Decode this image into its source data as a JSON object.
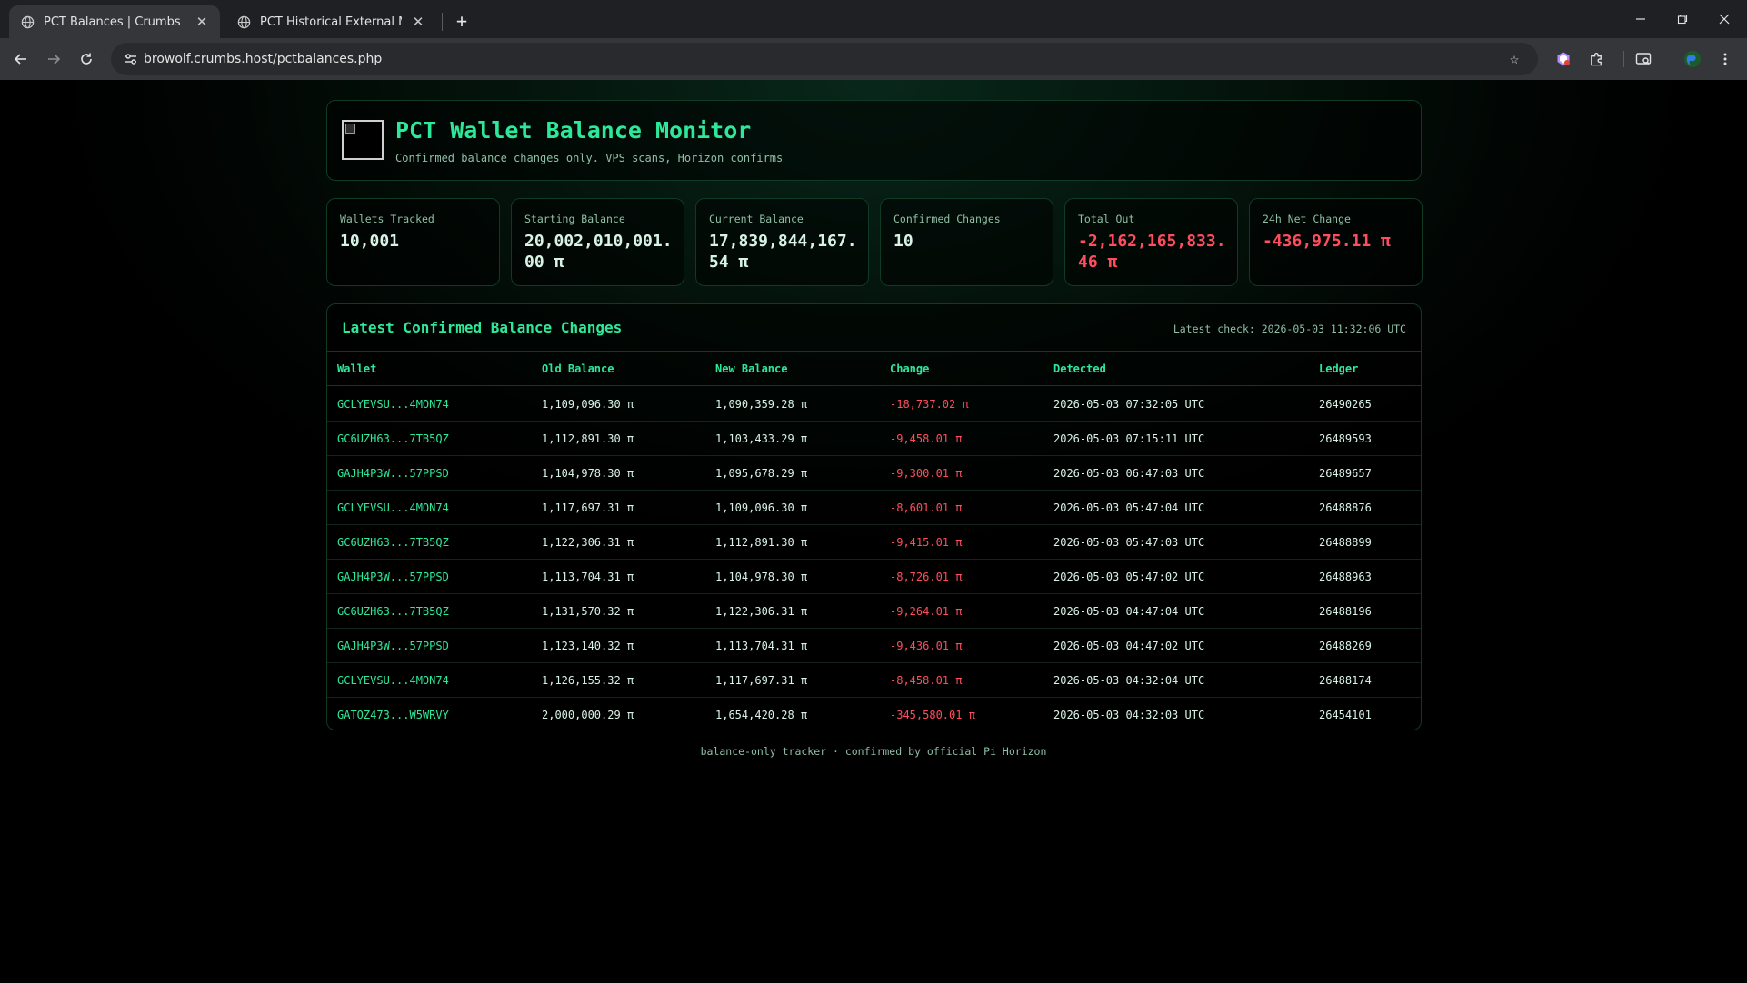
{
  "browser": {
    "tabs": [
      {
        "title": "PCT Balances | Crumbs",
        "active": true
      },
      {
        "title": "PCT Historical External Movements",
        "active": false
      }
    ],
    "url": "browolf.crumbs.host/pctbalances.php"
  },
  "header": {
    "title": "PCT Wallet Balance Monitor",
    "subtitle": "Confirmed balance changes only. VPS scans, Horizon confirms"
  },
  "stats": [
    {
      "label": "Wallets Tracked",
      "value": "10,001",
      "negative": false
    },
    {
      "label": "Starting Balance",
      "value": "20,002,010,001.00 π",
      "negative": false
    },
    {
      "label": "Current Balance",
      "value": "17,839,844,167.54 π",
      "negative": false
    },
    {
      "label": "Confirmed Changes",
      "value": "10",
      "negative": false
    },
    {
      "label": "Total Out",
      "value": "-2,162,165,833.46 π",
      "negative": true
    },
    {
      "label": "24h Net Change",
      "value": "-436,975.11 π",
      "negative": true
    }
  ],
  "table": {
    "title": "Latest Confirmed Balance Changes",
    "latest_check": "Latest check: 2026-05-03 11:32:06 UTC",
    "columns": [
      "Wallet",
      "Old Balance",
      "New Balance",
      "Change",
      "Detected",
      "Ledger"
    ],
    "rows": [
      [
        "GCLYEVSU...4MON74",
        "1,109,096.30 π",
        "1,090,359.28 π",
        "-18,737.02 π",
        "2026-05-03 07:32:05 UTC",
        "26490265"
      ],
      [
        "GC6UZH63...7TB5QZ",
        "1,112,891.30 π",
        "1,103,433.29 π",
        "-9,458.01 π",
        "2026-05-03 07:15:11 UTC",
        "26489593"
      ],
      [
        "GAJH4P3W...57PPSD",
        "1,104,978.30 π",
        "1,095,678.29 π",
        "-9,300.01 π",
        "2026-05-03 06:47:03 UTC",
        "26489657"
      ],
      [
        "GCLYEVSU...4MON74",
        "1,117,697.31 π",
        "1,109,096.30 π",
        "-8,601.01 π",
        "2026-05-03 05:47:04 UTC",
        "26488876"
      ],
      [
        "GC6UZH63...7TB5QZ",
        "1,122,306.31 π",
        "1,112,891.30 π",
        "-9,415.01 π",
        "2026-05-03 05:47:03 UTC",
        "26488899"
      ],
      [
        "GAJH4P3W...57PPSD",
        "1,113,704.31 π",
        "1,104,978.30 π",
        "-8,726.01 π",
        "2026-05-03 05:47:02 UTC",
        "26488963"
      ],
      [
        "GC6UZH63...7TB5QZ",
        "1,131,570.32 π",
        "1,122,306.31 π",
        "-9,264.01 π",
        "2026-05-03 04:47:04 UTC",
        "26488196"
      ],
      [
        "GAJH4P3W...57PPSD",
        "1,123,140.32 π",
        "1,113,704.31 π",
        "-9,436.01 π",
        "2026-05-03 04:47:02 UTC",
        "26488269"
      ],
      [
        "GCLYEVSU...4MON74",
        "1,126,155.32 π",
        "1,117,697.31 π",
        "-8,458.01 π",
        "2026-05-03 04:32:04 UTC",
        "26488174"
      ],
      [
        "GATOZ473...W5WRVY",
        "2,000,000.29 π",
        "1,654,420.28 π",
        "-345,580.01 π",
        "2026-05-03 04:32:03 UTC",
        "26454101"
      ]
    ]
  },
  "footer": "balance-only tracker · confirmed by official Pi Horizon",
  "colors": {
    "accent": "#2ee89a",
    "negative": "#ff4d5e",
    "muted": "#8fbfa6",
    "border": "#0f3a26"
  }
}
